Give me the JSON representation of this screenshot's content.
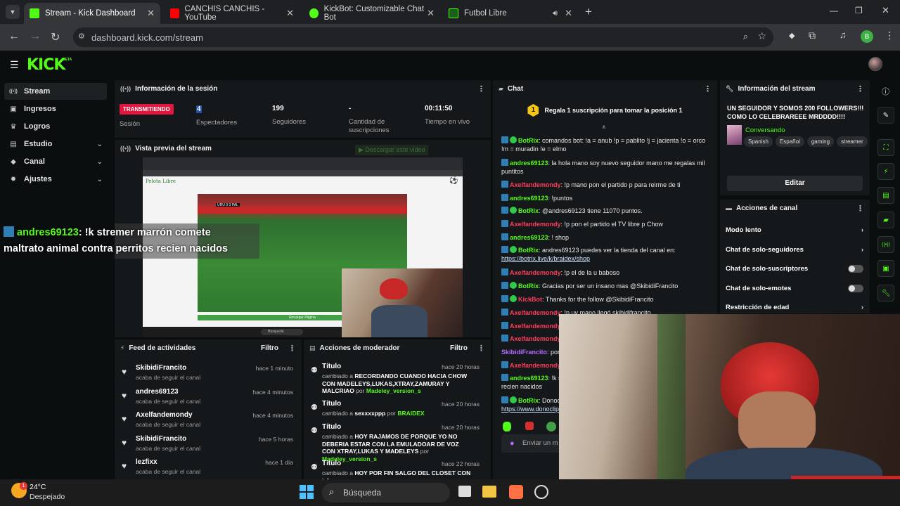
{
  "browser": {
    "tabs": [
      {
        "title": "Stream - Kick Dashboard",
        "active": true,
        "favicon_color": "#53fc18"
      },
      {
        "title": "CANCHIS CANCHIS - YouTube",
        "active": false,
        "favicon_color": "#ff0000"
      },
      {
        "title": "KickBot: Customizable Chat Bot",
        "active": false,
        "favicon_color": "#53fc18"
      },
      {
        "title": "Futbol Libre",
        "active": false,
        "favicon_color": "#53fc18"
      }
    ],
    "url": "dashboard.kick.com/stream",
    "profile_initial": "B"
  },
  "app": {
    "logo": "KICK",
    "logo_sup": "BETA",
    "accent": "#53fc18"
  },
  "sidebar": {
    "items": [
      {
        "label": "Stream",
        "icon": "broadcast-icon",
        "glyph": "((•))",
        "active": true,
        "chevron": false
      },
      {
        "label": "Ingresos",
        "icon": "wallet-icon",
        "glyph": "▣",
        "active": false,
        "chevron": false
      },
      {
        "label": "Logros",
        "icon": "trophy-icon",
        "glyph": "♛",
        "active": false,
        "chevron": false
      },
      {
        "label": "Estudio",
        "icon": "studio-icon",
        "glyph": "▤",
        "active": false,
        "chevron": true
      },
      {
        "label": "Canal",
        "icon": "channel-icon",
        "glyph": "◆",
        "active": false,
        "chevron": true
      },
      {
        "label": "Ajustes",
        "icon": "gear-icon",
        "glyph": "✹",
        "active": false,
        "chevron": true
      }
    ]
  },
  "session": {
    "title": "Información de la sesión",
    "live_badge": "TRANSMITIENDO",
    "live_label": "Sesión",
    "stats": [
      {
        "value": "4",
        "label": "Espectadores"
      },
      {
        "value": "199",
        "label": "Seguidores"
      },
      {
        "value": "-",
        "label": "Cantidad de suscripciones"
      },
      {
        "value": "00:11:50",
        "label": "Tiempo en vivo"
      }
    ]
  },
  "preview": {
    "title": "Vista previa del stream",
    "download": "Descargar este video",
    "inner_site": "Pelota Libre",
    "inner_button": "Recargar Página",
    "inner_search": "Búsqueda",
    "scoreboard": "URU 0-3 PAL",
    "overlay_user": "andres69123",
    "overlay_text_1": ": !k stremer marrón comete",
    "overlay_text_2": "maltrato animal contra perritos recien nacidos"
  },
  "feed": {
    "title": "Feed de actividades",
    "filter": "Filtro",
    "items": [
      {
        "name": "SkibidiFrancito",
        "sub": "acaba de seguir el canal",
        "time": "hace 1 minuto"
      },
      {
        "name": "andres69123",
        "sub": "acaba de seguir el canal",
        "time": "hace 4 minutos"
      },
      {
        "name": "Axelfandemondy",
        "sub": "acaba de seguir el canal",
        "time": "hace 4 minutos"
      },
      {
        "name": "SkibidiFrancito",
        "sub": "acaba de seguir el canal",
        "time": "hace 5 horas"
      },
      {
        "name": "lezfixx",
        "sub": "acaba de seguir el canal",
        "time": "hace 1 día"
      }
    ]
  },
  "mod": {
    "title": "Acciones de moderador",
    "filter": "Filtro",
    "items": [
      {
        "title": "Título",
        "time": "hace 20 horas",
        "prefix": "cambiado a",
        "text": "RECORDANDO CUANDO HACIA CHOW CON MADELEYS,LUKAS,XTRAY,ZAMURAY Y MALCRIAO",
        "by": "por",
        "user": "Madeley_version_s"
      },
      {
        "title": "Título",
        "time": "hace 20 horas",
        "prefix": "cambiado a",
        "text": "sexxxxppp",
        "by": "por",
        "user": "BRAIDEX"
      },
      {
        "title": "Título",
        "time": "hace 20 horas",
        "prefix": "cambiado a",
        "text": "HOY RAJAMOS DE PORQUE YO NO DEBERIA ESTAR CON LA EMULADOAR DE VOZ CON XTRAY,LUKAS Y MADELEYS",
        "by": "por",
        "user": "Madeley_version_s"
      },
      {
        "title": "Título",
        "time": "hace 22 horas",
        "prefix": "cambiado a",
        "text": "HOY POR FIN SALGO DEL CLOSET CON LA",
        "by": "",
        "user": ""
      }
    ]
  },
  "chat": {
    "title": "Chat",
    "pinned": "Regala 1 suscripción para tomar la posición 1",
    "pinned_rank": "1",
    "input_placeholder": "Enviar un m",
    "messages": [
      {
        "user": "BotRix",
        "color": "green",
        "verified": true,
        "text": ": comandos bot: !a = anub !p = pablito !j = jacienta !o = orco !m = muradin !e = elmo"
      },
      {
        "user": "andres69123",
        "color": "green",
        "verified": false,
        "text": ": la hola mano soy nuevo seguidor mano me regalas mil puntitos"
      },
      {
        "user": "Axelfandemondy",
        "color": "red",
        "verified": false,
        "text": ": !p mano pon el partido p para reirme de ti"
      },
      {
        "user": "andres69123",
        "color": "green",
        "verified": false,
        "text": ": !puntos"
      },
      {
        "user": "BotRix",
        "color": "green",
        "verified": true,
        "text": ": @andres69123 tiene 11070 puntos."
      },
      {
        "user": "Axelfandemondy",
        "color": "red",
        "verified": false,
        "text": ": !p pon el partido el TV libre p Chow"
      },
      {
        "user": "andres69123",
        "color": "green",
        "verified": false,
        "text": ": ! shop"
      },
      {
        "user": "BotRix",
        "color": "green",
        "verified": true,
        "text": ": andres69123 puedes ver la tienda del canal en:",
        "link": "https://botrix.live/k/braidex/shop"
      },
      {
        "user": "Axelfandemondy",
        "color": "red",
        "verified": false,
        "text": ": !p el de la u baboso"
      },
      {
        "user": "BotRix",
        "color": "green",
        "verified": true,
        "text": ": Gracias por ser un insano mas @SkibidiFrancito"
      },
      {
        "user": "KickBot",
        "color": "red",
        "verified": true,
        "text": ": Thanks for the follow @SkibidiFrancito"
      },
      {
        "user": "Axelfandemondy",
        "color": "red",
        "verified": false,
        "text": ": !p uy mano llegó skibidifrancito"
      },
      {
        "user": "Axelfandemondy",
        "color": "red",
        "verified": false,
        "text": ""
      },
      {
        "user": "Axelfandemondy",
        "color": "red",
        "verified": false,
        "text": ""
      },
      {
        "user": "SkibidiFrancito",
        "color": "purple",
        "verified": false,
        "text": ": porq"
      },
      {
        "user": "Axelfandemondy",
        "color": "red",
        "verified": false,
        "text": ""
      },
      {
        "user": "andres69123",
        "color": "green",
        "verified": false,
        "text": ": !k s",
        "text2": "recien nacidos"
      },
      {
        "user": "BotRix",
        "color": "green",
        "verified": true,
        "text": ": Donoc",
        "link": "https://www.donoclip"
      }
    ]
  },
  "stream_info": {
    "title": "Información del stream",
    "stream_title": "UN SEGUIDOR Y SOMOS 200 FOLLOWERS!!! COMO LO CELEBRAREEE MRDDDD!!!!",
    "category": "Conversando",
    "tags": [
      "Spanish",
      "Español",
      "gaming",
      "streamer"
    ],
    "edit": "Editar"
  },
  "channel_actions": {
    "title": "Acciones de canal",
    "items": [
      {
        "label": "Modo lento",
        "kind": "chevron"
      },
      {
        "label": "Chat de solo-seguidores",
        "kind": "chevron"
      },
      {
        "label": "Chat de solo-suscriptores",
        "kind": "toggle"
      },
      {
        "label": "Chat de solo-emotes",
        "kind": "toggle"
      },
      {
        "label": "Restricción de edad",
        "kind": "chevron"
      }
    ]
  },
  "taskbar": {
    "temp": "24°C",
    "weather": "Despejado",
    "weather_badge": "1",
    "search": "Búsqueda"
  }
}
